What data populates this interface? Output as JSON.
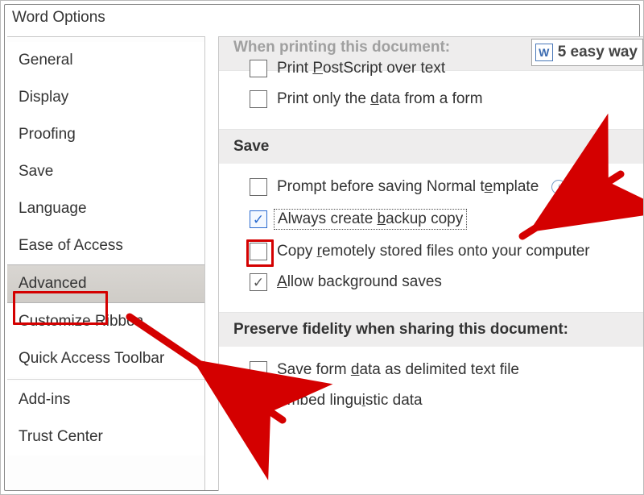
{
  "window": {
    "title": "Word Options"
  },
  "sidebar": {
    "items": [
      {
        "label": "General"
      },
      {
        "label": "Display"
      },
      {
        "label": "Proofing"
      },
      {
        "label": "Save"
      },
      {
        "label": "Language"
      },
      {
        "label": "Ease of Access"
      },
      {
        "label": "Advanced",
        "selected": true
      },
      {
        "label": "Customize Ribbon"
      },
      {
        "label": "Quick Access Toolbar"
      },
      {
        "label": "Add-ins"
      },
      {
        "label": "Trust Center"
      }
    ]
  },
  "content": {
    "printing_header_cut": "When printing this document:",
    "dropdown_cut": "5 easy way",
    "printing": {
      "postscript": {
        "label": "Print PostScript over text",
        "checked": false,
        "accel_index": 6
      },
      "dataonly": {
        "label": "Print only the data from a form",
        "checked": false,
        "accel_index": 15
      }
    },
    "save_header": "Save",
    "save": {
      "prompt": {
        "label": "Prompt before saving Normal template",
        "checked": false,
        "accel_index": 29
      },
      "backup": {
        "label": "Always create backup copy",
        "checked": true,
        "accel_index": 14
      },
      "remote": {
        "label": "Copy remotely stored files onto your computer",
        "checked": false,
        "accel_index": 5
      },
      "bg": {
        "label": "Allow background saves",
        "checked": true,
        "accel_index": 0
      }
    },
    "preserve_header": "Preserve fidelity when sharing this document:",
    "preserve": {
      "formdata": {
        "label": "Save form data as delimited text file",
        "checked": false,
        "accel_index": 10
      },
      "ling": {
        "label": "Embed linguistic data",
        "checked": true,
        "accel_index": 11
      }
    }
  }
}
